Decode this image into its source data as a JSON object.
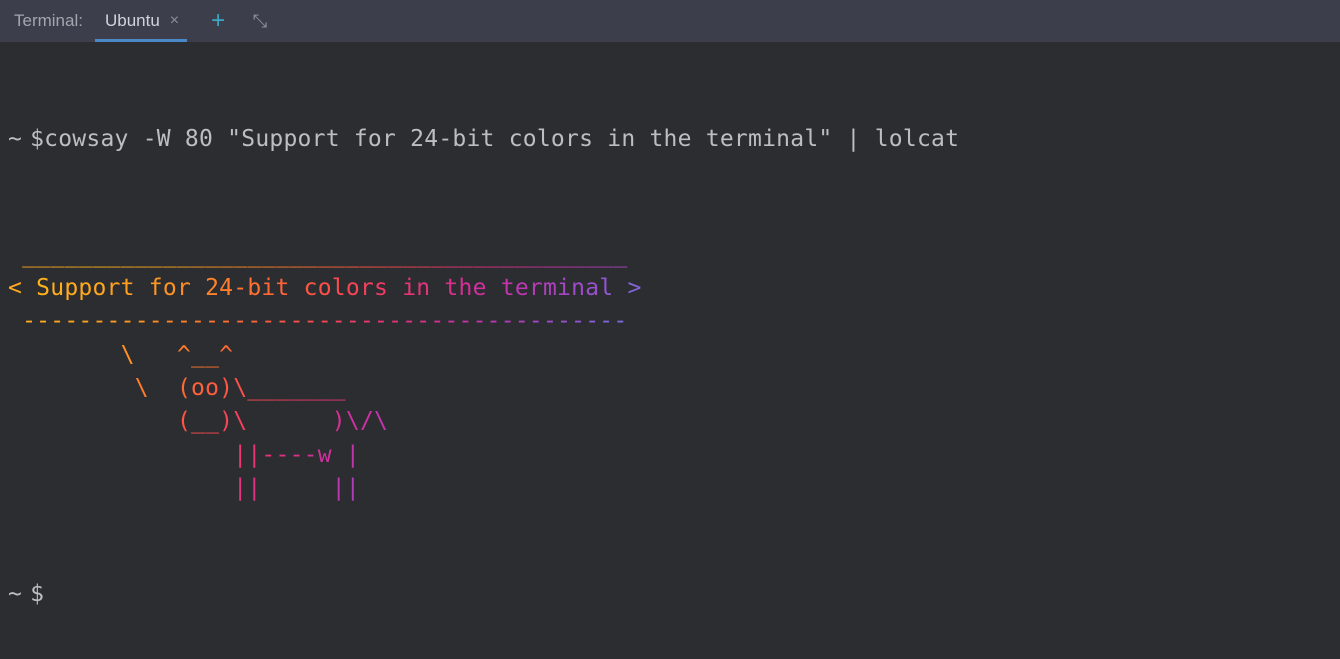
{
  "tabbar": {
    "title_prefix": "Terminal:",
    "active_tab": "Ubuntu",
    "close_glyph": "×",
    "plus_glyph": "+",
    "expand_glyph": "⤢"
  },
  "prompt": {
    "tilde": "~",
    "dollar": "$",
    "command": "cowsay -W 80 \"Support for 24-bit colors in the terminal\" | lolcat"
  },
  "lolcat_output": {
    "lines": [
      [
        {
          "t": " ",
          "c": "#ff9f1f"
        },
        {
          "t": "_",
          "c": "#ffa21e"
        },
        {
          "t": "_",
          "c": "#ffa51e"
        },
        {
          "t": "_",
          "c": "#ffa81d"
        },
        {
          "t": "_",
          "c": "#ffab1d"
        },
        {
          "t": "_",
          "c": "#ffae1c"
        },
        {
          "t": "_",
          "c": "#ffb11c"
        },
        {
          "t": "_",
          "c": "#ffae1c"
        },
        {
          "t": "_",
          "c": "#ffab1d"
        },
        {
          "t": "_",
          "c": "#ffa81d"
        },
        {
          "t": "_",
          "c": "#ffa51e"
        },
        {
          "t": "_",
          "c": "#ffa21e"
        },
        {
          "t": "_",
          "c": "#ff9f1f"
        },
        {
          "t": "_",
          "c": "#ff9b20"
        },
        {
          "t": "_",
          "c": "#ff9721"
        },
        {
          "t": "_",
          "c": "#ff9222"
        },
        {
          "t": "_",
          "c": "#ff8d24"
        },
        {
          "t": "_",
          "c": "#ff8826"
        },
        {
          "t": "_",
          "c": "#ff8228"
        },
        {
          "t": "_",
          "c": "#ff7c2b"
        },
        {
          "t": "_",
          "c": "#ff762e"
        },
        {
          "t": "_",
          "c": "#ff7031"
        },
        {
          "t": "_",
          "c": "#ff6935"
        },
        {
          "t": "_",
          "c": "#ff633a"
        },
        {
          "t": "_",
          "c": "#ff5c3f"
        },
        {
          "t": "_",
          "c": "#ff5644"
        },
        {
          "t": "_",
          "c": "#fd504a"
        },
        {
          "t": "_",
          "c": "#fb4a50"
        },
        {
          "t": "_",
          "c": "#f84457"
        },
        {
          "t": "_",
          "c": "#f5405e"
        },
        {
          "t": "_",
          "c": "#f13b66"
        },
        {
          "t": "_",
          "c": "#ed376d"
        },
        {
          "t": "_",
          "c": "#e93475"
        },
        {
          "t": "_",
          "c": "#e4327d"
        },
        {
          "t": "_",
          "c": "#df3085"
        },
        {
          "t": "_",
          "c": "#da2f8d"
        },
        {
          "t": "_",
          "c": "#d42f95"
        },
        {
          "t": "_",
          "c": "#ce309d"
        },
        {
          "t": "_",
          "c": "#c832a4"
        },
        {
          "t": "_",
          "c": "#c234ab"
        },
        {
          "t": "_",
          "c": "#bb38b2"
        },
        {
          "t": "_",
          "c": "#b43bb8"
        },
        {
          "t": "_",
          "c": "#ae40be"
        },
        {
          "t": "_",
          "c": "#a745c4"
        },
        {
          "t": " ",
          "c": "#a04ac9"
        }
      ],
      [
        {
          "t": "<",
          "c": "#ffab1d"
        },
        {
          "t": " ",
          "c": "#ffae1c"
        },
        {
          "t": "S",
          "c": "#ffb11c"
        },
        {
          "t": "u",
          "c": "#ffae1c"
        },
        {
          "t": "p",
          "c": "#ffab1d"
        },
        {
          "t": "p",
          "c": "#ffa81d"
        },
        {
          "t": "o",
          "c": "#ffa51e"
        },
        {
          "t": "r",
          "c": "#ffa21e"
        },
        {
          "t": "t",
          "c": "#ff9f1f"
        },
        {
          "t": " ",
          "c": "#ff9b20"
        },
        {
          "t": "f",
          "c": "#ff9721"
        },
        {
          "t": "o",
          "c": "#ff9222"
        },
        {
          "t": "r",
          "c": "#ff8d24"
        },
        {
          "t": " ",
          "c": "#ff8826"
        },
        {
          "t": "2",
          "c": "#ff8228"
        },
        {
          "t": "4",
          "c": "#ff7c2b"
        },
        {
          "t": "-",
          "c": "#ff762e"
        },
        {
          "t": "b",
          "c": "#ff7031"
        },
        {
          "t": "i",
          "c": "#ff6935"
        },
        {
          "t": "t",
          "c": "#ff633a"
        },
        {
          "t": " ",
          "c": "#ff5c3f"
        },
        {
          "t": "c",
          "c": "#ff5644"
        },
        {
          "t": "o",
          "c": "#fd504a"
        },
        {
          "t": "l",
          "c": "#fb4a50"
        },
        {
          "t": "o",
          "c": "#f84457"
        },
        {
          "t": "r",
          "c": "#f5405e"
        },
        {
          "t": "s",
          "c": "#f13b66"
        },
        {
          "t": " ",
          "c": "#ed376d"
        },
        {
          "t": "i",
          "c": "#e93475"
        },
        {
          "t": "n",
          "c": "#e4327d"
        },
        {
          "t": " ",
          "c": "#df3085"
        },
        {
          "t": "t",
          "c": "#da2f8d"
        },
        {
          "t": "h",
          "c": "#d42f95"
        },
        {
          "t": "e",
          "c": "#ce309d"
        },
        {
          "t": " ",
          "c": "#c832a4"
        },
        {
          "t": "t",
          "c": "#c234ab"
        },
        {
          "t": "e",
          "c": "#bb38b2"
        },
        {
          "t": "r",
          "c": "#b43bb8"
        },
        {
          "t": "m",
          "c": "#ae40be"
        },
        {
          "t": "i",
          "c": "#a745c4"
        },
        {
          "t": "n",
          "c": "#a04ac9"
        },
        {
          "t": "a",
          "c": "#9950cd"
        },
        {
          "t": "l",
          "c": "#9256d2"
        },
        {
          "t": " ",
          "c": "#8b5dd5"
        },
        {
          "t": ">",
          "c": "#8463d9"
        }
      ],
      [
        {
          "t": " ",
          "c": "#ffb11c"
        },
        {
          "t": "-",
          "c": "#ffae1c"
        },
        {
          "t": "-",
          "c": "#ffab1d"
        },
        {
          "t": "-",
          "c": "#ffa81d"
        },
        {
          "t": "-",
          "c": "#ffa51e"
        },
        {
          "t": "-",
          "c": "#ffa21e"
        },
        {
          "t": "-",
          "c": "#ff9f1f"
        },
        {
          "t": "-",
          "c": "#ff9b20"
        },
        {
          "t": "-",
          "c": "#ff9721"
        },
        {
          "t": "-",
          "c": "#ff9222"
        },
        {
          "t": "-",
          "c": "#ff8d24"
        },
        {
          "t": "-",
          "c": "#ff8826"
        },
        {
          "t": "-",
          "c": "#ff8228"
        },
        {
          "t": "-",
          "c": "#ff7c2b"
        },
        {
          "t": "-",
          "c": "#ff762e"
        },
        {
          "t": "-",
          "c": "#ff7031"
        },
        {
          "t": "-",
          "c": "#ff6935"
        },
        {
          "t": "-",
          "c": "#ff633a"
        },
        {
          "t": "-",
          "c": "#ff5c3f"
        },
        {
          "t": "-",
          "c": "#ff5644"
        },
        {
          "t": "-",
          "c": "#fd504a"
        },
        {
          "t": "-",
          "c": "#fb4a50"
        },
        {
          "t": "-",
          "c": "#f84457"
        },
        {
          "t": "-",
          "c": "#f5405e"
        },
        {
          "t": "-",
          "c": "#f13b66"
        },
        {
          "t": "-",
          "c": "#ed376d"
        },
        {
          "t": "-",
          "c": "#e93475"
        },
        {
          "t": "-",
          "c": "#e4327d"
        },
        {
          "t": "-",
          "c": "#df3085"
        },
        {
          "t": "-",
          "c": "#da2f8d"
        },
        {
          "t": "-",
          "c": "#d42f95"
        },
        {
          "t": "-",
          "c": "#ce309d"
        },
        {
          "t": "-",
          "c": "#c832a4"
        },
        {
          "t": "-",
          "c": "#c234ab"
        },
        {
          "t": "-",
          "c": "#bb38b2"
        },
        {
          "t": "-",
          "c": "#b43bb8"
        },
        {
          "t": "-",
          "c": "#ae40be"
        },
        {
          "t": "-",
          "c": "#a745c4"
        },
        {
          "t": "-",
          "c": "#a04ac9"
        },
        {
          "t": "-",
          "c": "#9950cd"
        },
        {
          "t": "-",
          "c": "#9256d2"
        },
        {
          "t": "-",
          "c": "#8b5dd5"
        },
        {
          "t": "-",
          "c": "#8463d9"
        },
        {
          "t": "-",
          "c": "#7d6adb"
        },
        {
          "t": " ",
          "c": "#7770de"
        }
      ],
      [
        {
          "t": " ",
          "c": "#ffae1c"
        },
        {
          "t": " ",
          "c": "#ffab1d"
        },
        {
          "t": " ",
          "c": "#ffa81d"
        },
        {
          "t": " ",
          "c": "#ffa51e"
        },
        {
          "t": " ",
          "c": "#ffa21e"
        },
        {
          "t": " ",
          "c": "#ff9f1f"
        },
        {
          "t": " ",
          "c": "#ff9b20"
        },
        {
          "t": " ",
          "c": "#ff9721"
        },
        {
          "t": "\\",
          "c": "#ff9222"
        },
        {
          "t": " ",
          "c": "#ff8d24"
        },
        {
          "t": " ",
          "c": "#ff8826"
        },
        {
          "t": " ",
          "c": "#ff8228"
        },
        {
          "t": "^",
          "c": "#ff7c2b"
        },
        {
          "t": "_",
          "c": "#ff762e"
        },
        {
          "t": "_",
          "c": "#ff7031"
        },
        {
          "t": "^",
          "c": "#ff6935"
        }
      ],
      [
        {
          "t": " ",
          "c": "#ffa51e"
        },
        {
          "t": " ",
          "c": "#ffa21e"
        },
        {
          "t": " ",
          "c": "#ff9f1f"
        },
        {
          "t": " ",
          "c": "#ff9b20"
        },
        {
          "t": " ",
          "c": "#ff9721"
        },
        {
          "t": " ",
          "c": "#ff9222"
        },
        {
          "t": " ",
          "c": "#ff8d24"
        },
        {
          "t": " ",
          "c": "#ff8826"
        },
        {
          "t": " ",
          "c": "#ff8228"
        },
        {
          "t": "\\",
          "c": "#ff7c2b"
        },
        {
          "t": " ",
          "c": "#ff762e"
        },
        {
          "t": " ",
          "c": "#ff7031"
        },
        {
          "t": "(",
          "c": "#ff6935"
        },
        {
          "t": "o",
          "c": "#ff633a"
        },
        {
          "t": "o",
          "c": "#ff5c3f"
        },
        {
          "t": ")",
          "c": "#ff5644"
        },
        {
          "t": "\\",
          "c": "#fd504a"
        },
        {
          "t": "_",
          "c": "#fb4a50"
        },
        {
          "t": "_",
          "c": "#f84457"
        },
        {
          "t": "_",
          "c": "#f5405e"
        },
        {
          "t": "_",
          "c": "#f13b66"
        },
        {
          "t": "_",
          "c": "#ed376d"
        },
        {
          "t": "_",
          "c": "#e93475"
        },
        {
          "t": "_",
          "c": "#e4327d"
        }
      ],
      [
        {
          "t": " ",
          "c": "#ff9b20"
        },
        {
          "t": " ",
          "c": "#ff9721"
        },
        {
          "t": " ",
          "c": "#ff9222"
        },
        {
          "t": " ",
          "c": "#ff8d24"
        },
        {
          "t": " ",
          "c": "#ff8826"
        },
        {
          "t": " ",
          "c": "#ff8228"
        },
        {
          "t": " ",
          "c": "#ff7c2b"
        },
        {
          "t": " ",
          "c": "#ff762e"
        },
        {
          "t": " ",
          "c": "#ff7031"
        },
        {
          "t": " ",
          "c": "#ff6935"
        },
        {
          "t": " ",
          "c": "#ff633a"
        },
        {
          "t": " ",
          "c": "#ff5c3f"
        },
        {
          "t": "(",
          "c": "#ff5644"
        },
        {
          "t": "_",
          "c": "#fd504a"
        },
        {
          "t": "_",
          "c": "#fb4a50"
        },
        {
          "t": ")",
          "c": "#f84457"
        },
        {
          "t": "\\",
          "c": "#f5405e"
        },
        {
          "t": " ",
          "c": "#f13b66"
        },
        {
          "t": " ",
          "c": "#ed376d"
        },
        {
          "t": " ",
          "c": "#e93475"
        },
        {
          "t": " ",
          "c": "#e4327d"
        },
        {
          "t": " ",
          "c": "#df3085"
        },
        {
          "t": " ",
          "c": "#da2f8d"
        },
        {
          "t": ")",
          "c": "#d42f95"
        },
        {
          "t": "\\",
          "c": "#ce309d"
        },
        {
          "t": "/",
          "c": "#c832a4"
        },
        {
          "t": "\\",
          "c": "#c234ab"
        }
      ],
      [
        {
          "t": " ",
          "c": "#ff9222"
        },
        {
          "t": " ",
          "c": "#ff8d24"
        },
        {
          "t": " ",
          "c": "#ff8826"
        },
        {
          "t": " ",
          "c": "#ff8228"
        },
        {
          "t": " ",
          "c": "#ff7c2b"
        },
        {
          "t": " ",
          "c": "#ff762e"
        },
        {
          "t": " ",
          "c": "#ff7031"
        },
        {
          "t": " ",
          "c": "#ff6935"
        },
        {
          "t": " ",
          "c": "#ff633a"
        },
        {
          "t": " ",
          "c": "#ff5c3f"
        },
        {
          "t": " ",
          "c": "#ff5644"
        },
        {
          "t": " ",
          "c": "#fd504a"
        },
        {
          "t": " ",
          "c": "#fb4a50"
        },
        {
          "t": " ",
          "c": "#f84457"
        },
        {
          "t": " ",
          "c": "#f5405e"
        },
        {
          "t": " ",
          "c": "#f13b66"
        },
        {
          "t": "|",
          "c": "#ed376d"
        },
        {
          "t": "|",
          "c": "#e93475"
        },
        {
          "t": "-",
          "c": "#e4327d"
        },
        {
          "t": "-",
          "c": "#df3085"
        },
        {
          "t": "-",
          "c": "#da2f8d"
        },
        {
          "t": "-",
          "c": "#d42f95"
        },
        {
          "t": "w",
          "c": "#ce309d"
        },
        {
          "t": " ",
          "c": "#c832a4"
        },
        {
          "t": "|",
          "c": "#c234ab"
        }
      ],
      [
        {
          "t": " ",
          "c": "#ff8826"
        },
        {
          "t": " ",
          "c": "#ff8228"
        },
        {
          "t": " ",
          "c": "#ff7c2b"
        },
        {
          "t": " ",
          "c": "#ff762e"
        },
        {
          "t": " ",
          "c": "#ff7031"
        },
        {
          "t": " ",
          "c": "#ff6935"
        },
        {
          "t": " ",
          "c": "#ff633a"
        },
        {
          "t": " ",
          "c": "#ff5c3f"
        },
        {
          "t": " ",
          "c": "#ff5644"
        },
        {
          "t": " ",
          "c": "#fd504a"
        },
        {
          "t": " ",
          "c": "#fb4a50"
        },
        {
          "t": " ",
          "c": "#f84457"
        },
        {
          "t": " ",
          "c": "#f5405e"
        },
        {
          "t": " ",
          "c": "#f13b66"
        },
        {
          "t": " ",
          "c": "#ed376d"
        },
        {
          "t": " ",
          "c": "#e93475"
        },
        {
          "t": "|",
          "c": "#e4327d"
        },
        {
          "t": "|",
          "c": "#df3085"
        },
        {
          "t": " ",
          "c": "#da2f8d"
        },
        {
          "t": " ",
          "c": "#d42f95"
        },
        {
          "t": " ",
          "c": "#ce309d"
        },
        {
          "t": " ",
          "c": "#c832a4"
        },
        {
          "t": " ",
          "c": "#c234ab"
        },
        {
          "t": "|",
          "c": "#bb38b2"
        },
        {
          "t": "|",
          "c": "#b43bb8"
        }
      ]
    ]
  }
}
